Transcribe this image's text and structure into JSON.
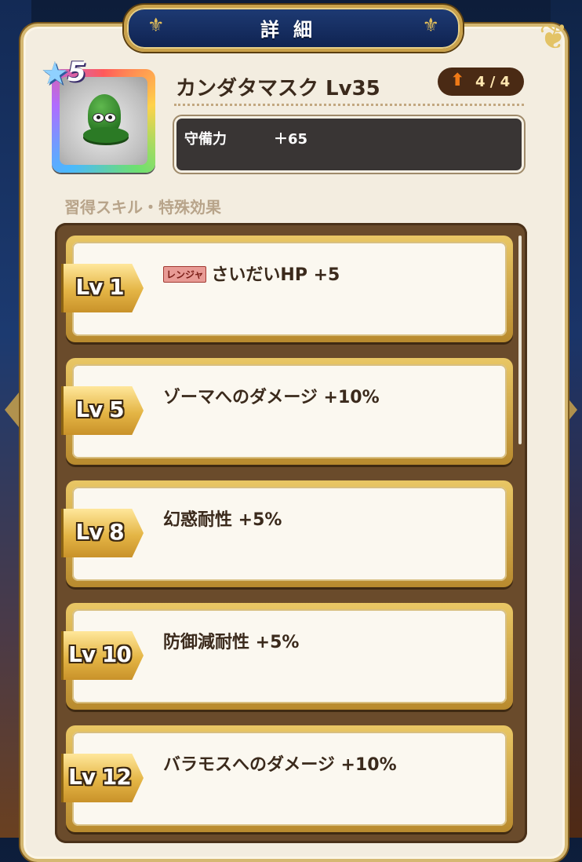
{
  "header": {
    "title": "詳細"
  },
  "item": {
    "rarity": "5",
    "name": "カンダタマスク Lv35",
    "count": "4 / 4",
    "stats": [
      {
        "label": "守備力",
        "value": "＋65"
      }
    ]
  },
  "section_title": "習得スキル・特殊効果",
  "skills": [
    {
      "level": "Lv 1",
      "tag": "レンジャ",
      "description": "さいだいHP +5"
    },
    {
      "level": "Lv 5",
      "tag": "",
      "description": "ゾーマへのダメージ +10%"
    },
    {
      "level": "Lv 8",
      "tag": "",
      "description": "幻惑耐性 +5%"
    },
    {
      "level": "Lv 10",
      "tag": "",
      "description": "防御減耐性 +5%"
    },
    {
      "level": "Lv 12",
      "tag": "",
      "description": "バラモスへのダメージ +10%"
    }
  ],
  "colors": {
    "accent_gold": "#c9a14a",
    "panel": "#f3ede0",
    "title_bar": "#1e3b74",
    "count_arrow": "#f07a17"
  }
}
